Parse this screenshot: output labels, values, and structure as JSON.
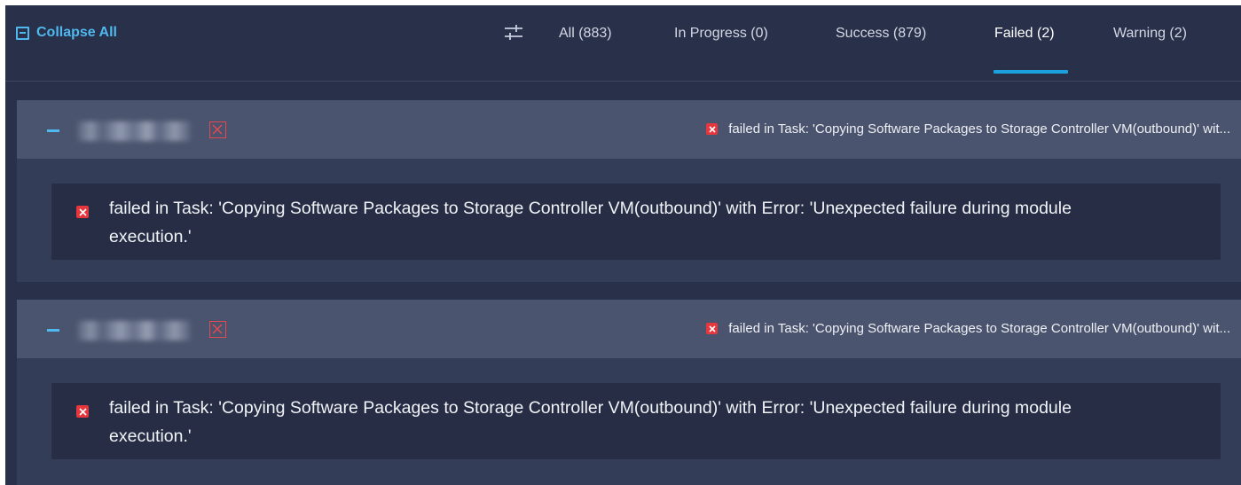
{
  "toolbar": {
    "collapse_all_label": "Collapse All",
    "filter_icon": "filter-sliders-icon",
    "tabs": [
      {
        "label": "All (883)",
        "active": false
      },
      {
        "label": "In Progress (0)",
        "active": false
      },
      {
        "label": "Success (879)",
        "active": false
      },
      {
        "label": "Failed (2)",
        "active": true
      },
      {
        "label": "Warning (2)",
        "active": false
      }
    ]
  },
  "groups": [
    {
      "collapse_icon": "minus-icon",
      "name_blurred": true,
      "status_icon": "failed-box-icon",
      "header_message": "failed in Task: 'Copying Software Packages to Storage Controller VM(outbound)' wit...",
      "detail_message": "failed in Task: 'Copying Software Packages to Storage Controller VM(outbound)' with Error: 'Unexpected failure during module execution.'"
    },
    {
      "collapse_icon": "minus-icon",
      "name_blurred": true,
      "status_icon": "failed-box-icon",
      "header_message": "failed in Task: 'Copying Software Packages to Storage Controller VM(outbound)' wit...",
      "detail_message": "failed in Task: 'Copying Software Packages to Storage Controller VM(outbound)' with Error: 'Unexpected failure during module execution.'"
    }
  ],
  "colors": {
    "background": "#28304a",
    "group_header": "#4b546e",
    "card": "#262d45",
    "accent": "#4fb8ee",
    "tab_underline": "#1aa1de",
    "error": "#e5373d"
  }
}
